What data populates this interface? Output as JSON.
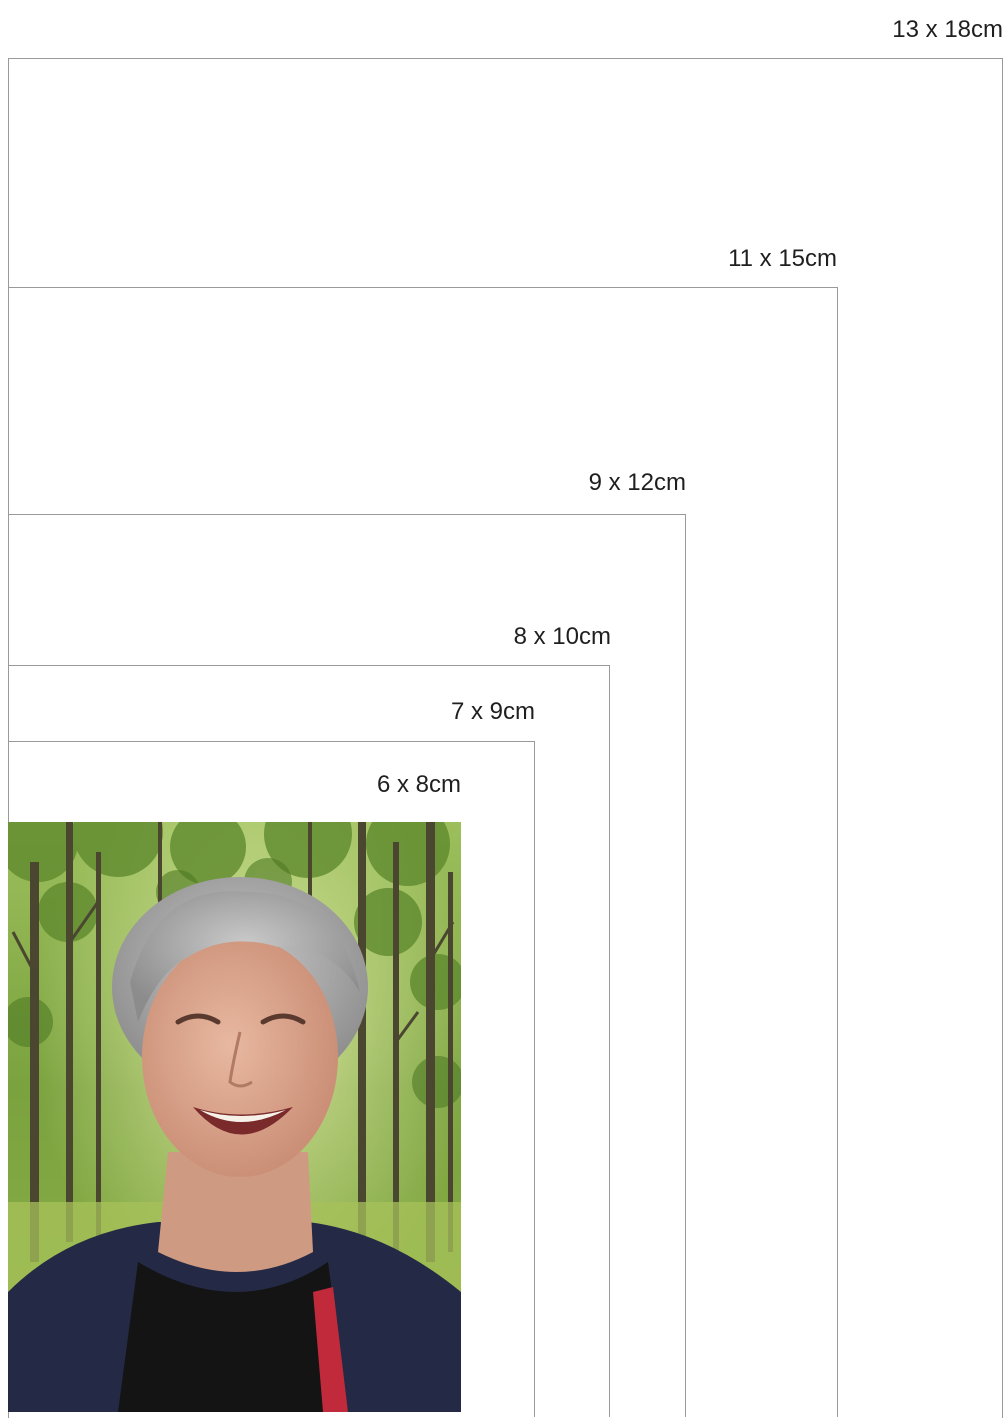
{
  "sizes": [
    {
      "label": "13 x 18cm"
    },
    {
      "label": "11 x 15cm"
    },
    {
      "label": "9 x 12cm"
    },
    {
      "label": "8 x 10cm"
    },
    {
      "label": "7 x 9cm"
    },
    {
      "label": "6 x 8cm"
    }
  ],
  "photo": {
    "subject": "smiling woman with short grey hair in a forest",
    "colors": {
      "foliage": "#6f9a3a",
      "trunk": "#4a4630",
      "hair": "#a9a9a9",
      "skin": "#d9a58e",
      "cardigan": "#242a45",
      "shirt": "#c02a3a"
    }
  }
}
